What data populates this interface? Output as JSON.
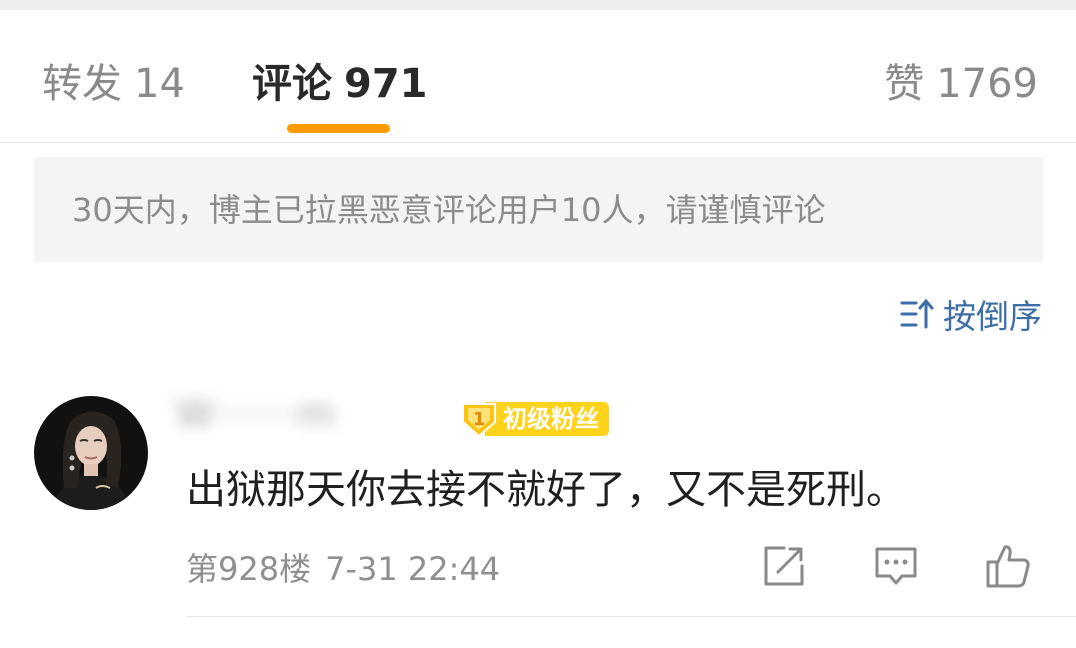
{
  "tabs": [
    {
      "label": "转发",
      "count": "14"
    },
    {
      "label": "评论",
      "count": "971"
    },
    {
      "label": "赞",
      "count": "1769"
    }
  ],
  "notice": "30天内，博主已拉黑恶意评论用户10人，请谨慎评论",
  "sort_label": "按倒序",
  "comment": {
    "username": "W·······m",
    "fan_badge": {
      "level": "1",
      "label": "初级粉丝"
    },
    "text": "出狱那天你去接不就好了，又不是死刑。",
    "floor": "第928楼",
    "time": "7-31 22:44"
  },
  "icons": {
    "sort": "sort-icon",
    "share": "share-icon",
    "reply": "comment-icon",
    "like": "thumbs-up-icon"
  },
  "colors": {
    "accent": "#ff9a00",
    "link": "#3d6ea8",
    "badge": "#ffd21c"
  }
}
